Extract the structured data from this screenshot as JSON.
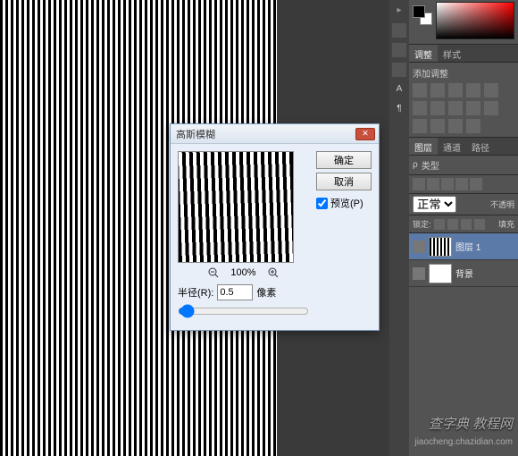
{
  "dialog": {
    "title": "高斯模糊",
    "ok_label": "确定",
    "cancel_label": "取消",
    "preview_label": "预览(P)",
    "zoom_percent": "100%",
    "radius_label": "半径(R):",
    "radius_value": "0.5",
    "radius_unit": "像素"
  },
  "panels": {
    "adjust_tab": "调整",
    "style_tab": "样式",
    "add_adjust_label": "添加调整",
    "layers_tab": "图层",
    "channels_tab": "通道",
    "paths_tab": "路径",
    "kind_label": "类型",
    "blend_mode": "正常",
    "opacity_label": "不透明",
    "lock_label": "锁定:",
    "fill_label": "填充"
  },
  "layers": [
    {
      "name": "图层 1",
      "thumb_bg": "repeating-linear-gradient(90deg,#000 0,#000 2px,#fff 2px,#fff 4px)",
      "selected": true
    },
    {
      "name": "背景",
      "thumb_bg": "#fff",
      "selected": false
    }
  ],
  "watermark": {
    "main": "查字典 教程网",
    "sub": "jiaocheng.chazidian.com"
  }
}
